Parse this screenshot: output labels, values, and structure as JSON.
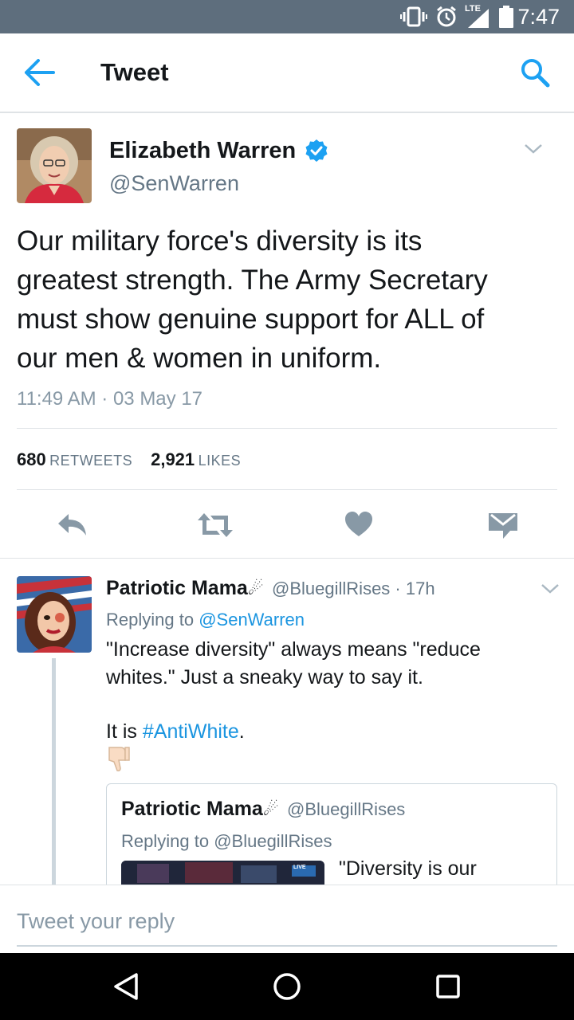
{
  "status_bar": {
    "time": "7:47",
    "network": "LTE"
  },
  "app_bar": {
    "title": "Tweet",
    "back_icon": "arrow-left-icon",
    "search_icon": "search-icon",
    "accent": "#1da1f2"
  },
  "main_tweet": {
    "author_name": "Elizabeth Warren",
    "handle": "@SenWarren",
    "verified": true,
    "text_lines": [
      "Our military force's diversity is its",
      "greatest strength. The Army Secretary",
      "must show genuine support for ALL of",
      "our men & women in uniform."
    ],
    "timestamp": "11:49 AM · 03 May 17",
    "retweets_count": "680",
    "retweets_label": "RETWEETS",
    "likes_count": "2,921",
    "likes_label": "LIKES"
  },
  "actions": [
    "reply-icon",
    "retweet-icon",
    "like-icon",
    "direct-message-icon"
  ],
  "reply": {
    "author_name": "Patriotic Mama",
    "name_emoji": "☄",
    "handle_time": "@BluegillRises · 17h",
    "replying_prefix": "Replying to",
    "replying_to": "@SenWarren",
    "text_line1": "\"Increase diversity\" always means \"reduce",
    "text_line2": "whites.\" Just a sneaky way to say it.",
    "text_line3_prefix": "It is",
    "hashtag": "#AntiWhite",
    "text_line3_suffix": ".",
    "emoji": "👎🏻"
  },
  "quote": {
    "author_name": "Patriotic Mama",
    "name_emoji": "☄",
    "handle": "@BluegillRises",
    "replying_prefix": "Replying to",
    "replying_to": "@BluegillRises",
    "text": "\"Diversity is our",
    "media_badge": "LIVE"
  },
  "composer": {
    "placeholder": "Tweet your reply"
  },
  "nav_bar": {
    "buttons": [
      "back-triangle-icon",
      "home-circle-icon",
      "recents-square-icon"
    ]
  }
}
